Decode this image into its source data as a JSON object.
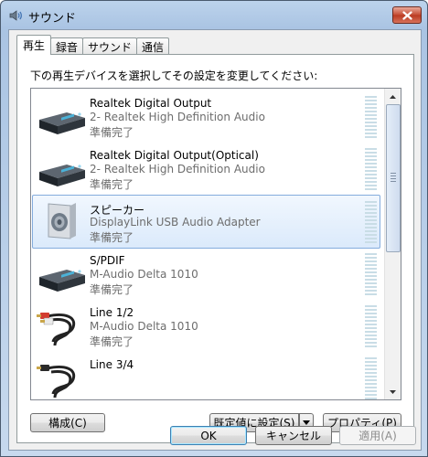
{
  "window": {
    "title": "サウンド",
    "close_icon": "close-icon"
  },
  "tabs": [
    {
      "label": "再生",
      "active": true
    },
    {
      "label": "録音",
      "active": false
    },
    {
      "label": "サウンド",
      "active": false
    },
    {
      "label": "通信",
      "active": false
    }
  ],
  "instruction": "下の再生デバイスを選択してその設定を変更してください:",
  "devices": [
    {
      "name": "Realtek Digital Output",
      "description": "2- Realtek High Definition Audio",
      "status": "準備完了",
      "icon": "digital-output-icon"
    },
    {
      "name": "Realtek Digital Output(Optical)",
      "description": "2- Realtek High Definition Audio",
      "status": "準備完了",
      "icon": "digital-output-icon"
    },
    {
      "name": "スピーカー",
      "description": "DisplayLink USB Audio Adapter",
      "status": "準備完了",
      "icon": "speaker-icon",
      "selected": true
    },
    {
      "name": "S/PDIF",
      "description": "M-Audio Delta 1010",
      "status": "準備完了",
      "icon": "digital-output-icon"
    },
    {
      "name": "Line 1/2",
      "description": "M-Audio Delta 1010",
      "status": "準備完了",
      "icon": "rca-cable-icon"
    },
    {
      "name": "Line 3/4",
      "description": "",
      "status": "",
      "icon": "rca-cable-icon"
    }
  ],
  "buttons": {
    "configure": "構成(C)",
    "set_default": "既定値に設定(S)",
    "properties": "プロパティ(P)",
    "ok": "OK",
    "cancel": "キャンセル",
    "apply": "適用(A)"
  }
}
